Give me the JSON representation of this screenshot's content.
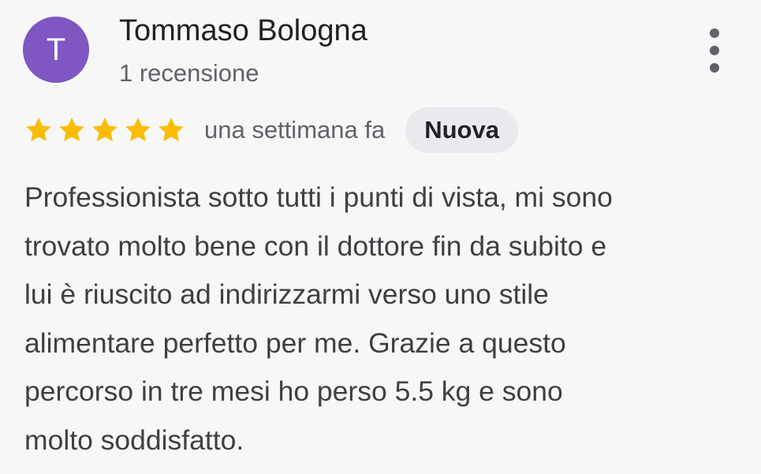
{
  "author": {
    "initial": "T",
    "name": "Tommaso Bologna",
    "review_count": "1 recensione",
    "avatar_color": "#7e57c2"
  },
  "menu": {
    "icon": "more-vert-icon"
  },
  "rating": {
    "stars": 5,
    "max_stars": 5,
    "star_color": "#fbbc04",
    "date": "una settimana fa",
    "badge": "Nuova"
  },
  "review": {
    "text": "Professionista sotto tutti i punti di vista, mi sono\ntrovato molto bene con il dottore fin da subito e\nlui è riuscito ad indirizzarmi verso uno stile\nalimentare perfetto per me. Grazie a questo\npercorso in tre mesi ho perso 5.5 kg e sono\nmolto soddisfatto."
  }
}
